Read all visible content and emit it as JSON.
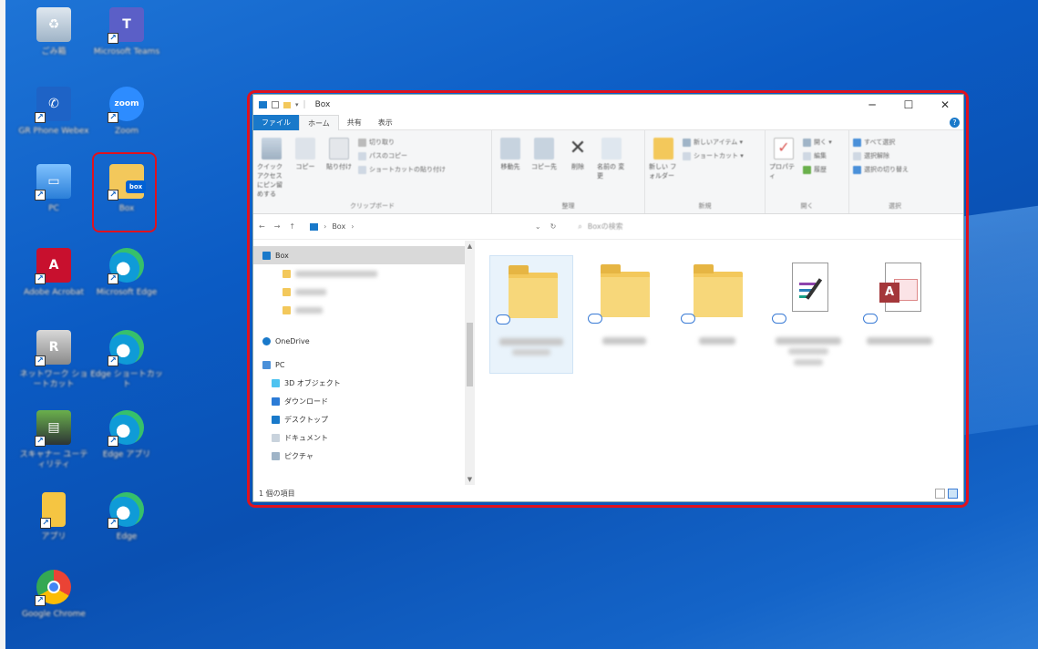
{
  "desktop": {
    "icons": [
      {
        "name": "ごみ箱",
        "icon": "recycle-bin-icon"
      },
      {
        "name": "Microsoft Teams",
        "icon": "teams-icon"
      },
      {
        "name": "GR Phone Webex",
        "icon": "phone-icon"
      },
      {
        "name": "Zoom",
        "icon": "zoom-icon"
      },
      {
        "name": "PC",
        "icon": "pc-icon"
      },
      {
        "name": "Box",
        "icon": "box-icon"
      },
      {
        "name": "Adobe Acrobat",
        "icon": "acrobat-icon"
      },
      {
        "name": "Microsoft Edge",
        "icon": "edge-icon"
      },
      {
        "name": "ネットワーク ショートカット",
        "icon": "network-icon"
      },
      {
        "name": "Edge ショートカット",
        "icon": "edge-icon"
      },
      {
        "name": "スキャナー ユーティリティ",
        "icon": "scanner-icon"
      },
      {
        "name": "Edge アプリ",
        "icon": "edge-icon"
      },
      {
        "name": "アプリ",
        "icon": "folder-icon"
      },
      {
        "name": "Edge",
        "icon": "edge-icon"
      },
      {
        "name": "Google Chrome",
        "icon": "chrome-icon"
      }
    ],
    "box_icon_badge": "box"
  },
  "window": {
    "title": "Box",
    "controls": {
      "minimize": "─",
      "maximize": "☐",
      "close": "✕"
    },
    "tabs": [
      "ファイル",
      "ホーム",
      "共有",
      "表示"
    ],
    "help": "?",
    "ribbon": {
      "groups": [
        {
          "name": "クリップボード",
          "buttons": [
            "クイック アクセス にピン留めする",
            "コピー",
            "貼り付け"
          ],
          "small": [
            "切り取り",
            "パスのコピー",
            "ショートカットの貼り付け"
          ]
        },
        {
          "name": "整理",
          "buttons": [
            "移動先",
            "コピー先",
            "削除",
            "名前の 変更"
          ]
        },
        {
          "name": "新規",
          "buttons": [
            "新しい フォルダー"
          ],
          "small": [
            "新しいアイテム ▾",
            "ショートカット ▾"
          ]
        },
        {
          "name": "開く",
          "buttons": [
            "プロパティ"
          ],
          "small": [
            "開く ▾",
            "編集",
            "履歴"
          ]
        },
        {
          "name": "選択",
          "small": [
            "すべて選択",
            "選択解除",
            "選択の切り替え"
          ]
        }
      ]
    },
    "address": {
      "back": "←",
      "forward": "→",
      "up": "↑",
      "path": [
        "Box",
        "›"
      ],
      "refresh": "↻",
      "search_placeholder": "Boxの検索"
    },
    "nav": {
      "box": "Box",
      "onedrive": "OneDrive",
      "pc": "PC",
      "pc_items": [
        "3D オブジェクト",
        "ダウンロード",
        "デスクトップ",
        "ドキュメント",
        "ピクチャ"
      ]
    },
    "files": [
      {
        "type": "folder"
      },
      {
        "type": "folder"
      },
      {
        "type": "folder"
      },
      {
        "type": "note"
      },
      {
        "type": "access"
      }
    ],
    "access_letter": "A",
    "status": "1 個の項目"
  }
}
